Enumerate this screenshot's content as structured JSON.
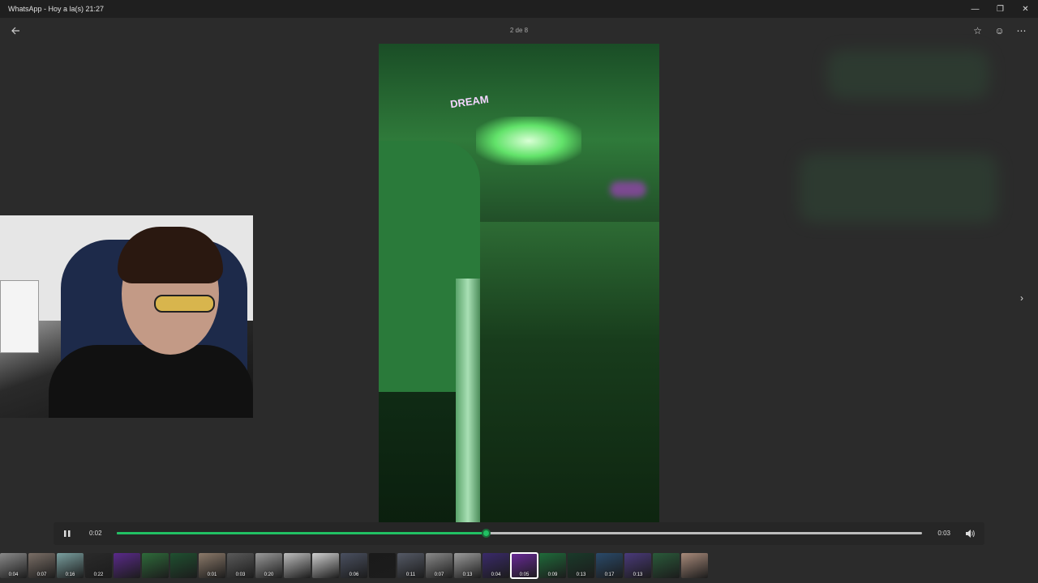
{
  "window": {
    "title": "WhatsApp - Hoy a la(s) 21:27",
    "controls": {
      "minimize": "—",
      "restore": "❐",
      "close": "✕"
    }
  },
  "viewer": {
    "counter": "2 de 8",
    "back_icon": "arrow-left-icon",
    "icons": {
      "star": "☆",
      "emoji": "☺",
      "more": "⋯"
    },
    "next_icon": "›"
  },
  "player": {
    "current_time": "0:02",
    "total_time": "0:03",
    "progress": 0.458,
    "accent_color": "#21c063"
  },
  "video_overlay": {
    "sign": "DREAM"
  },
  "thumbnails": [
    {
      "duration": "0:04",
      "color": "#8a8a8a"
    },
    {
      "duration": "0:07",
      "color": "#7a6e66"
    },
    {
      "duration": "0:16",
      "color": "#7aa0a0"
    },
    {
      "duration": "0:22",
      "color": "#2a2a2a"
    },
    {
      "duration": "",
      "color": "#5a2a8a"
    },
    {
      "duration": "",
      "color": "#2e6a3a"
    },
    {
      "duration": "",
      "color": "#1f5030"
    },
    {
      "duration": "0:01",
      "color": "#8c7a6a"
    },
    {
      "duration": "0:03",
      "color": "#5a5a5a"
    },
    {
      "duration": "0:20",
      "color": "#9a9a9a"
    },
    {
      "duration": "",
      "color": "#bdbdbd"
    },
    {
      "duration": "",
      "color": "#cfcfcf"
    },
    {
      "duration": "0:06",
      "color": "#4a5060"
    },
    {
      "duration": "",
      "color": "#1a1a1a"
    },
    {
      "duration": "0:11",
      "color": "#555a66"
    },
    {
      "duration": "0:07",
      "color": "#8a8a8a"
    },
    {
      "duration": "0:13",
      "color": "#9c9c9c"
    },
    {
      "duration": "0:04",
      "color": "#3a2a6a"
    },
    {
      "duration": "0:05",
      "color": "#6a2a9a",
      "selected": true
    },
    {
      "duration": "0:09",
      "color": "#1f6a3a"
    },
    {
      "duration": "0:13",
      "color": "#1a3a2a"
    },
    {
      "duration": "0:17",
      "color": "#2a4a6a"
    },
    {
      "duration": "0:13",
      "color": "#4a3a7a"
    },
    {
      "duration": "",
      "color": "#2a5a3a"
    },
    {
      "duration": "",
      "color": "#a88a7a"
    }
  ]
}
